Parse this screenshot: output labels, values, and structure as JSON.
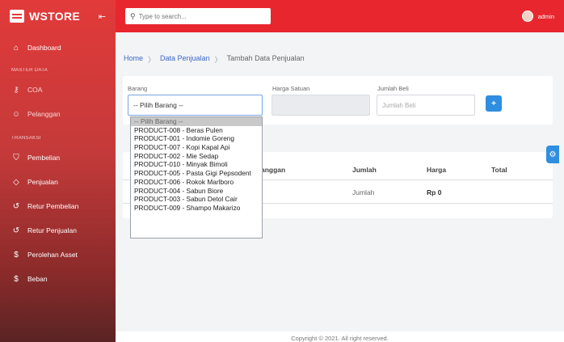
{
  "brand": {
    "name": "WSTORE",
    "collapse_icon": "collapse-icon"
  },
  "sidebar": {
    "dashboard": "Dashboard",
    "section_master": "MASTER DATA",
    "coa": "COA",
    "pelanggan": "Pelanggan",
    "section_transaksi": "TRANSAKSI",
    "pembelian": "Pembelian",
    "penjualan": "Penjualan",
    "retur_pembelian": "Retur Pembelian",
    "retur_penjualan": "Retur Penjualan",
    "perolehan_asset": "Perolehan Asset",
    "beban": "Beban"
  },
  "topbar": {
    "search_placeholder": "Type to search...",
    "user": "admin"
  },
  "breadcrumb": {
    "home": "Home",
    "sep": "〉",
    "data_penjualan": "Data Penjualan",
    "current": "Tambah Data Penjualan"
  },
  "form": {
    "barang_label": "Barang",
    "barang_value": "-- Pilih Barang --",
    "harga_label": "Harga Satuan",
    "jumlah_label": "Jumlah Beli",
    "jumlah_placeholder": "Jumlah Beli",
    "add_icon": "+"
  },
  "dropdown": {
    "options": [
      "-- Pilih Barang --",
      "PRODUCT-008 - Beras Pulen",
      "PRODUCT-001 - Indomie Goreng",
      "PRODUCT-007 - Kopi Kapal Api",
      "PRODUCT-002 - Mie Sedap",
      "PRODUCT-010 - Minyak Bimoli",
      "PRODUCT-005 - Pasta Gigi Pepsodent",
      "PRODUCT-006 - Rokok Marlboro",
      "PRODUCT-004 - Sabun Biore",
      "PRODUCT-003 - Sabun Detol Cair",
      "PRODUCT-009 - Shampo Makarizo"
    ]
  },
  "table": {
    "headers": {
      "pelanggan": "anggan",
      "jumlah": "Jumlah",
      "harga": "Harga",
      "total": "Total"
    },
    "row": {
      "jumlah": "Jumlah",
      "harga": "Rp 0"
    }
  },
  "footer": {
    "text": "Copyright © 2021. All right reserved."
  },
  "colors": {
    "accent": "#e8262e",
    "primary": "#2f8ee0"
  }
}
